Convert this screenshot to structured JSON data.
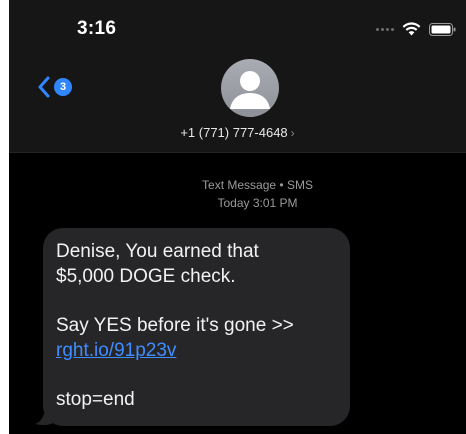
{
  "status_bar": {
    "time": "3:16"
  },
  "nav": {
    "unread_count": "3"
  },
  "contact": {
    "phone": "+1 (771) 777-4648",
    "chevron": "›"
  },
  "thread": {
    "message_type": "Text Message • SMS",
    "timestamp": "Today 3:01 PM"
  },
  "message": {
    "line1": "Denise, You earned that",
    "line2": "$5,000 DOGE check.",
    "line3": "Say YES before it's gone >>",
    "link": "rght.io/91p23v",
    "line4": "stop=end"
  },
  "colors": {
    "background": "#000000",
    "header": "#161616",
    "bubble": "#262628",
    "accent": "#2f86ff",
    "link": "#3f8dff"
  }
}
